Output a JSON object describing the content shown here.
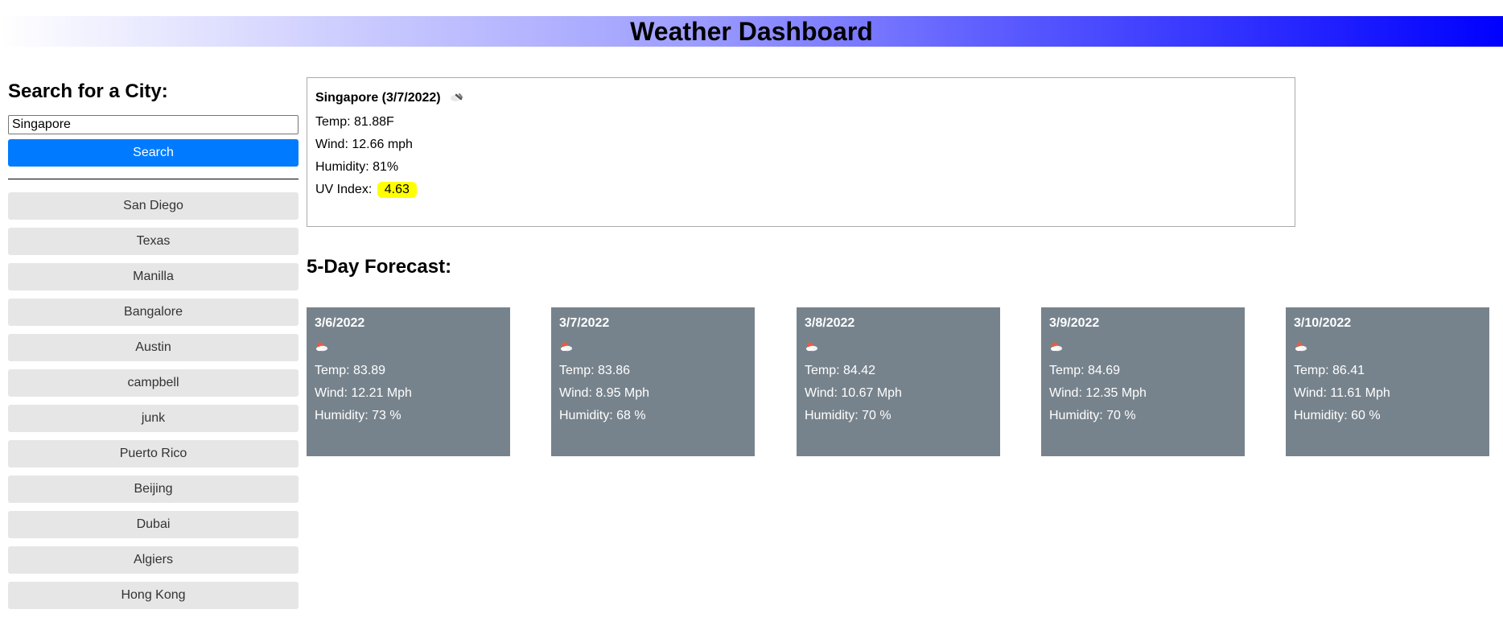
{
  "header": {
    "title": "Weather Dashboard"
  },
  "sidebar": {
    "title": "Search for a City:",
    "search_value": "Singapore",
    "search_button": "Search",
    "history": [
      "San Diego",
      "Texas",
      "Manilla",
      "Bangalore",
      "Austin",
      "campbell",
      "junk",
      "Puerto Rico",
      "Beijing",
      "Dubai",
      "Algiers",
      "Hong Kong"
    ]
  },
  "current": {
    "title": "Singapore (3/7/2022)",
    "icon": "cloud-icon",
    "temp": "Temp: 81.88F",
    "wind": "Wind: 12.66 mph",
    "humidity": "Humidity: 81%",
    "uv_label": "UV Index:",
    "uv_value": "4.63",
    "uv_color": "#ffff00"
  },
  "forecast": {
    "title": "5-Day Forecast:",
    "card_color": "#77838c",
    "days": [
      {
        "date": "3/6/2022",
        "icon": "partly-cloudy-icon",
        "temp": "Temp: 83.89",
        "wind": "Wind: 12.21 Mph",
        "humidity": "Humidity: 73 %"
      },
      {
        "date": "3/7/2022",
        "icon": "partly-cloudy-icon",
        "temp": "Temp: 83.86",
        "wind": "Wind: 8.95 Mph",
        "humidity": "Humidity: 68 %"
      },
      {
        "date": "3/8/2022",
        "icon": "partly-cloudy-icon",
        "temp": "Temp: 84.42",
        "wind": "Wind: 10.67 Mph",
        "humidity": "Humidity: 70 %"
      },
      {
        "date": "3/9/2022",
        "icon": "partly-cloudy-icon",
        "temp": "Temp: 84.69",
        "wind": "Wind: 12.35 Mph",
        "humidity": "Humidity: 70 %"
      },
      {
        "date": "3/10/2022",
        "icon": "partly-cloudy-icon",
        "temp": "Temp: 86.41",
        "wind": "Wind: 11.61 Mph",
        "humidity": "Humidity: 60 %"
      }
    ]
  },
  "colors": {
    "search_button": "#007bff",
    "history_item": "#e6e6e6"
  }
}
